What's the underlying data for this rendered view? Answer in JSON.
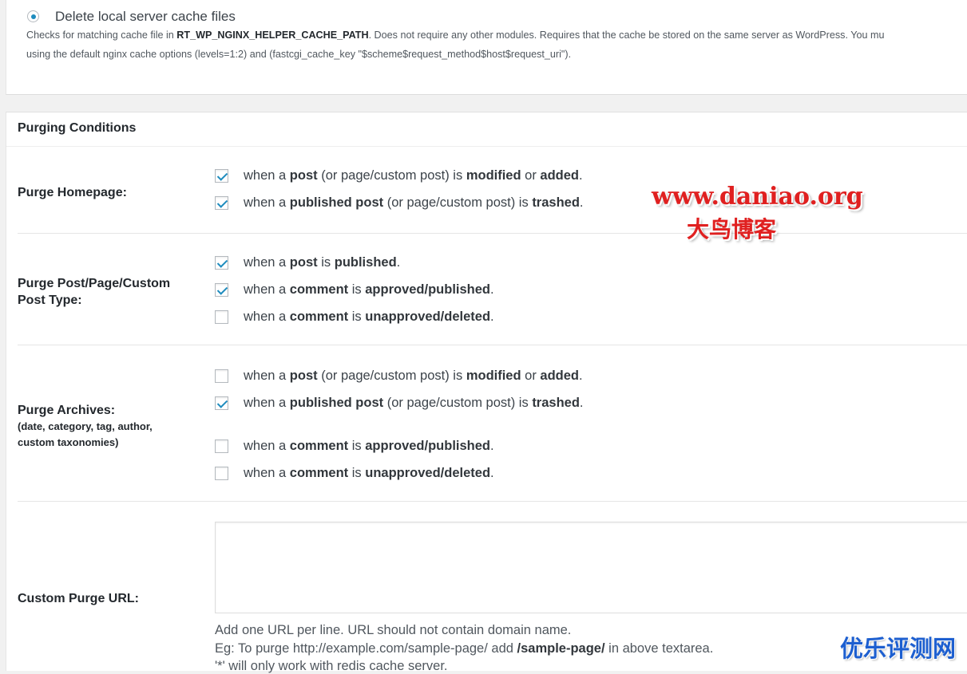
{
  "cache_method": {
    "radio_label": "Delete local server cache files",
    "desc_line1_pre": "Checks for matching cache file in ",
    "desc_line1_bold": "RT_WP_NGINX_HELPER_CACHE_PATH",
    "desc_line1_post": ". Does not require any other modules. Requires that the cache be stored on the same server as WordPress. You mu",
    "desc_line2": "using the default nginx cache options (levels=1:2) and (fastcgi_cache_key \"$scheme$request_method$host$request_uri\")."
  },
  "purging": {
    "title": "Purging Conditions",
    "homepage": {
      "label": "Purge Homepage:",
      "options": [
        {
          "checked": true,
          "p1": "when a ",
          "b1": "post",
          "p2": " (or page/custom post) is ",
          "b2": "modified",
          "p3": " or ",
          "b3": "added",
          "p4": "."
        },
        {
          "checked": true,
          "p1": "when a ",
          "b1": "published post",
          "p2": " (or page/custom post) is ",
          "b2": "trashed",
          "p3": ".",
          "b3": "",
          "p4": ""
        }
      ]
    },
    "post_type": {
      "label_line1": "Purge Post/Page/Custom",
      "label_line2": "Post Type:",
      "options": [
        {
          "checked": true,
          "p1": "when a ",
          "b1": "post",
          "p2": " is ",
          "b2": "published",
          "p3": "."
        },
        {
          "checked": true,
          "p1": "when a ",
          "b1": "comment",
          "p2": " is ",
          "b2": "approved/published",
          "p3": "."
        },
        {
          "checked": false,
          "p1": "when a ",
          "b1": "comment",
          "p2": " is ",
          "b2": "unapproved/deleted",
          "p3": "."
        }
      ]
    },
    "archives": {
      "label": "Purge Archives:",
      "sub_line1": "(date, category, tag, author,",
      "sub_line2": "custom taxonomies)",
      "options": [
        {
          "checked": false,
          "p1": "when a ",
          "b1": "post",
          "p2": " (or page/custom post) is ",
          "b2": "modified",
          "p3": " or ",
          "b3": "added",
          "p4": "."
        },
        {
          "checked": true,
          "p1": "when a ",
          "b1": "published post",
          "p2": " (or page/custom post) is ",
          "b2": "trashed",
          "p3": ".",
          "b3": "",
          "p4": ""
        },
        {
          "checked": false,
          "p1": "when a ",
          "b1": "comment",
          "p2": " is ",
          "b2": "approved/published",
          "p3": ".",
          "b3": "",
          "p4": ""
        },
        {
          "checked": false,
          "p1": "when a ",
          "b1": "comment",
          "p2": " is ",
          "b2": "unapproved/deleted",
          "p3": ".",
          "b3": "",
          "p4": ""
        }
      ]
    },
    "custom_url": {
      "label": "Custom Purge URL:",
      "textarea_value": "",
      "help_line1": "Add one URL per line. URL should not contain domain name.",
      "help_line2_pre": "Eg: To purge http://example.com/sample-page/ add ",
      "help_line2_bold": "/sample-page/",
      "help_line2_post": " in above textarea.",
      "help_line3": "'*' will only work with redis cache server."
    }
  },
  "watermarks": {
    "site_url": "www.daniao.org",
    "site_name": "大鸟博客",
    "corner": "优乐评测网"
  }
}
